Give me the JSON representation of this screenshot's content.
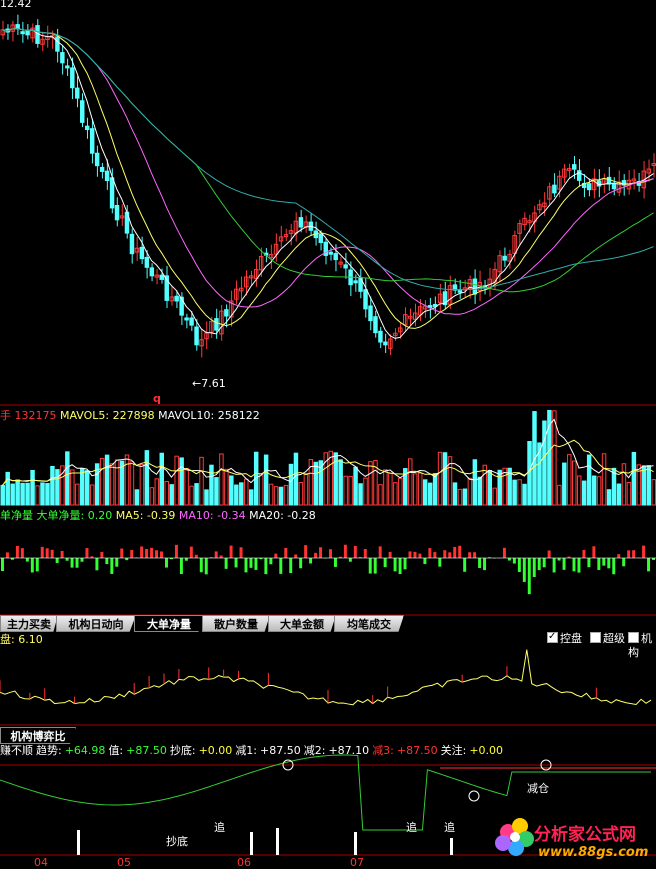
{
  "price_panel": {
    "high_label": "12.42",
    "low_label": "7.61",
    "marker_q": "q",
    "colors": {
      "up": "#ff3b3b",
      "down": "#54ffff",
      "ma_white": "#ffffff",
      "ma_yellow": "#ffff66",
      "ma_pink": "#ff66ff",
      "ma_green": "#33cc33",
      "ma_teal": "#33aaaa"
    }
  },
  "volume_panel": {
    "label_prefix": "手",
    "label_value": "132175",
    "mavol5": "MAVOL5: 227898",
    "mavol10": "MAVOL10: 258122"
  },
  "big_order_panel": {
    "title": "单净量",
    "name": "大单净量:",
    "value": "0.20",
    "ma5": "MA5: -0.39",
    "ma10": "MA10: -0.34",
    "ma20": "MA20: -0.28"
  },
  "tabs": [
    {
      "label": "主力买卖",
      "active": false
    },
    {
      "label": "机构日动向",
      "active": false
    },
    {
      "label": "大单净量",
      "active": true
    },
    {
      "label": "散户数量",
      "active": false
    },
    {
      "label": "大单金额",
      "active": false
    },
    {
      "label": "均笔成交",
      "active": false
    }
  ],
  "checkboxes": [
    {
      "label": "控盘",
      "checked": true
    },
    {
      "label": "超级",
      "checked": false
    },
    {
      "label": "机构",
      "checked": false
    }
  ],
  "control_panel": {
    "title": "盘: 6.10"
  },
  "game_panel": {
    "tab_label": "机构博弈比",
    "line": [
      {
        "text": "赚不顺",
        "color": "#ffffff"
      },
      {
        "text": "趋势:",
        "color": "#ffffff"
      },
      {
        "text": "+64.98",
        "color": "#33ff33"
      },
      {
        "text": "值:",
        "color": "#ffffff"
      },
      {
        "text": "+87.50",
        "color": "#33ff33"
      },
      {
        "text": "抄底:",
        "color": "#ffffff"
      },
      {
        "text": "+0.00",
        "color": "#ffff33"
      },
      {
        "text": "减1:",
        "color": "#ffffff"
      },
      {
        "text": "+87.50",
        "color": "#ffffff"
      },
      {
        "text": "减2:",
        "color": "#ffffff"
      },
      {
        "text": "+87.10",
        "color": "#ffffff"
      },
      {
        "text": "减3:",
        "color": "#ff3333"
      },
      {
        "text": "+87.50",
        "color": "#ff3333"
      },
      {
        "text": "关注:",
        "color": "#ffffff"
      },
      {
        "text": "+0.00",
        "color": "#ffff33"
      }
    ],
    "annotations": {
      "chaodi": "抄底",
      "zhui1": "追",
      "zhui2": "追",
      "zhui3": "追",
      "jiancang": "减仓"
    }
  },
  "x_axis": {
    "labels": [
      "04",
      "05",
      "06",
      "07"
    ]
  },
  "watermark": {
    "text": "分析家公式网",
    "url": "www.88gs.com"
  }
}
